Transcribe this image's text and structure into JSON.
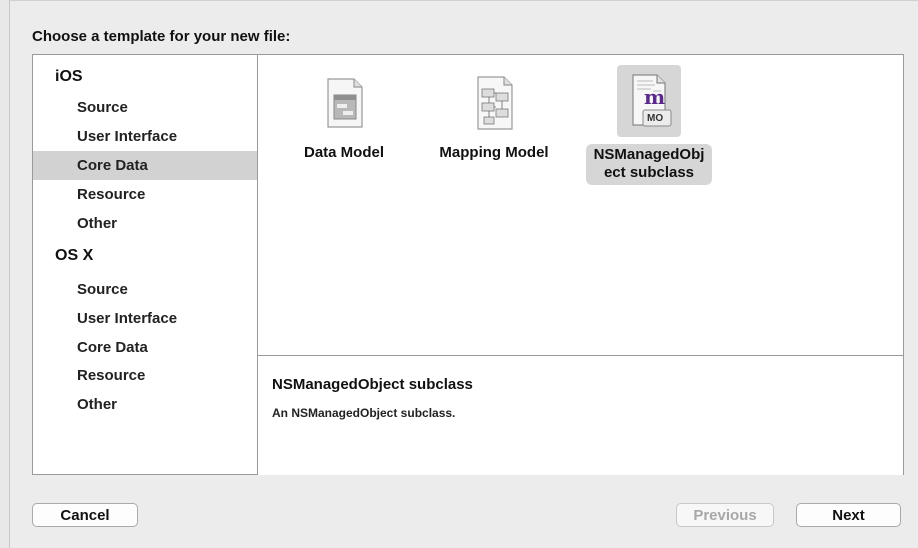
{
  "dialog": {
    "prompt": "Choose a template for your new file:"
  },
  "sidebar": {
    "platforms": [
      {
        "name": "iOS",
        "categories": [
          "Source",
          "User Interface",
          "Core Data",
          "Resource",
          "Other"
        ],
        "selected_index": 2
      },
      {
        "name": "OS X",
        "categories": [
          "Source",
          "User Interface",
          "Core Data",
          "Resource",
          "Other"
        ],
        "selected_index": -1
      }
    ]
  },
  "templates": [
    {
      "label": "Data Model",
      "icon": "data-model-icon",
      "selected": false
    },
    {
      "label": "Mapping Model",
      "icon": "mapping-model-icon",
      "selected": false
    },
    {
      "label_line1": "NSManagedObj",
      "label_line2": "ect subclass",
      "icon": "nsmanagedobject-icon",
      "badge": "MO",
      "glyph": "m",
      "selected": true
    }
  ],
  "description": {
    "title": "NSManagedObject subclass",
    "text": "An NSManagedObject subclass."
  },
  "buttons": {
    "cancel": "Cancel",
    "previous": "Previous",
    "next": "Next"
  },
  "colors": {
    "selection": "#d2d2d2",
    "border": "#9a9a9a"
  }
}
